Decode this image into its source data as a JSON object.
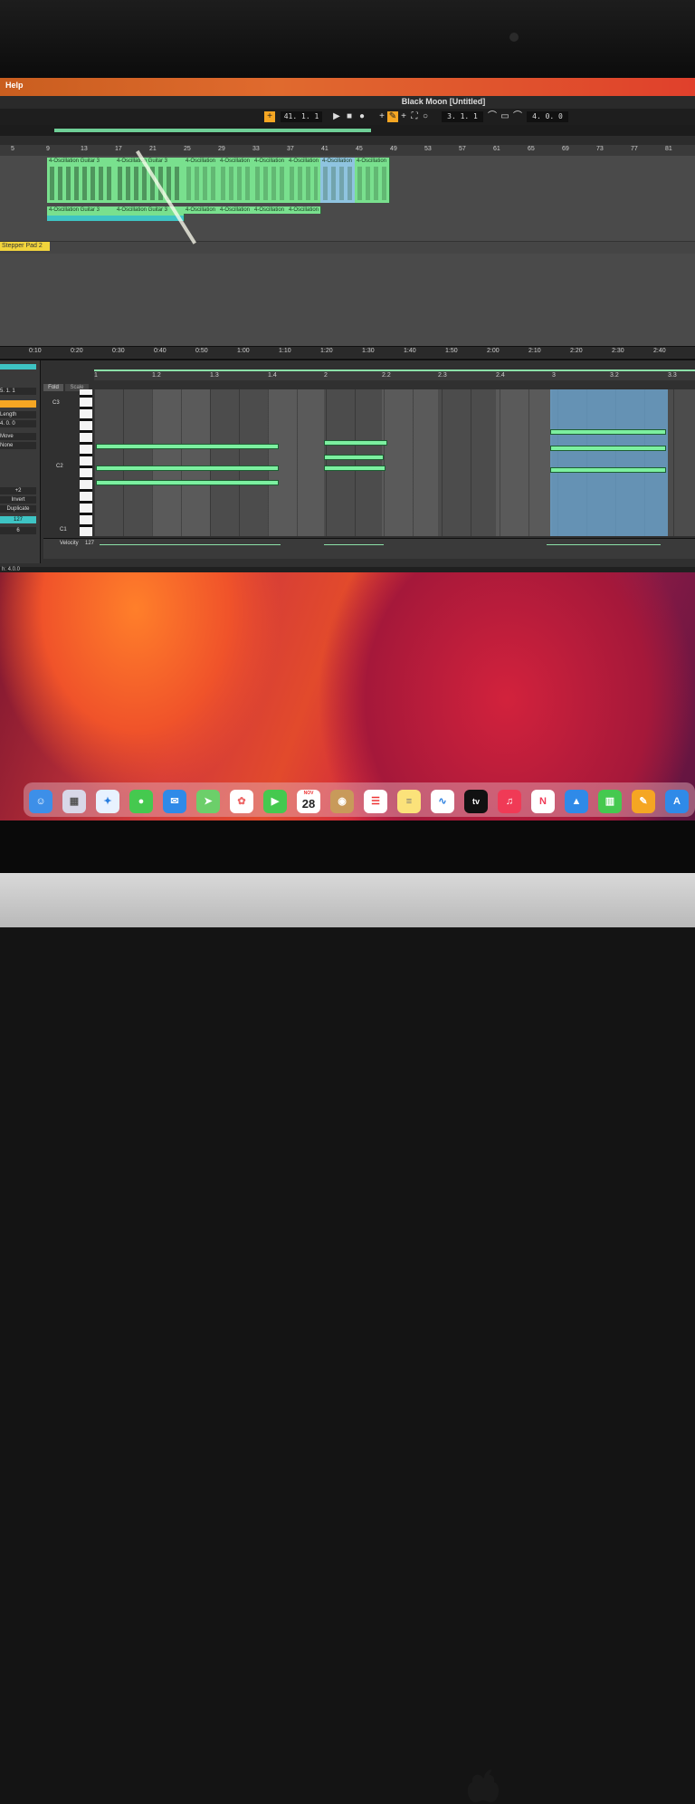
{
  "menubar": {
    "help": "Help"
  },
  "window": {
    "title": "Black Moon  [Untitled]"
  },
  "transport": {
    "position": "41. 1. 1",
    "loop_start": "3. 1. 1",
    "loop_length": "4. 0. 0"
  },
  "arrangement": {
    "beat_ruler": [
      "5",
      "9",
      "13",
      "17",
      "21",
      "25",
      "29",
      "33",
      "37",
      "41",
      "45",
      "49",
      "53",
      "57",
      "61",
      "65",
      "69",
      "73",
      "77",
      "81"
    ],
    "time_ruler": [
      "0:10",
      "0:20",
      "0:30",
      "0:40",
      "0:50",
      "1:00",
      "1:10",
      "1:20",
      "1:30",
      "1:40",
      "1:50",
      "2:00",
      "2:10",
      "2:20",
      "2:30",
      "2:40"
    ],
    "clips_row1": [
      "4-Oscillation Guitar 3",
      "4-Oscillation Guitar 3",
      "4-Oscillation",
      "4-Oscillation",
      "4-Oscillation",
      "4-Oscillation",
      "4-Oscillation"
    ],
    "clips_row2": [
      "4-Oscillation Guitar 3",
      "4-Oscillation Guitar 3",
      "4-Oscillation",
      "4-Oscillation",
      "4-Oscillation"
    ],
    "yellow_clip": "Stepper Pad 2"
  },
  "clip_editor": {
    "fold": "Fold",
    "scale": "Scale",
    "ruler": [
      "1",
      "1.2",
      "1.3",
      "1.4",
      "2",
      "2.2",
      "2.3",
      "2.4",
      "3",
      "3.2",
      "3.3"
    ],
    "octaves": [
      "C3",
      "C2",
      "C1"
    ],
    "velocity_label": "Velocity",
    "velocity_value": "127",
    "left_panel": {
      "start": "5. 1. 1",
      "length_label": "Length",
      "length_value": "4. 0. 0",
      "move": "Move",
      "none": "None",
      "transpose": "+2",
      "invert": "Invert",
      "duplicate": "Duplicate",
      "velocity": "127",
      "value": "6"
    }
  },
  "status": {
    "text": "h: 4.0.0"
  },
  "dock": {
    "calendar_month": "NOV",
    "calendar_day": "28",
    "tv_label": "tv"
  }
}
